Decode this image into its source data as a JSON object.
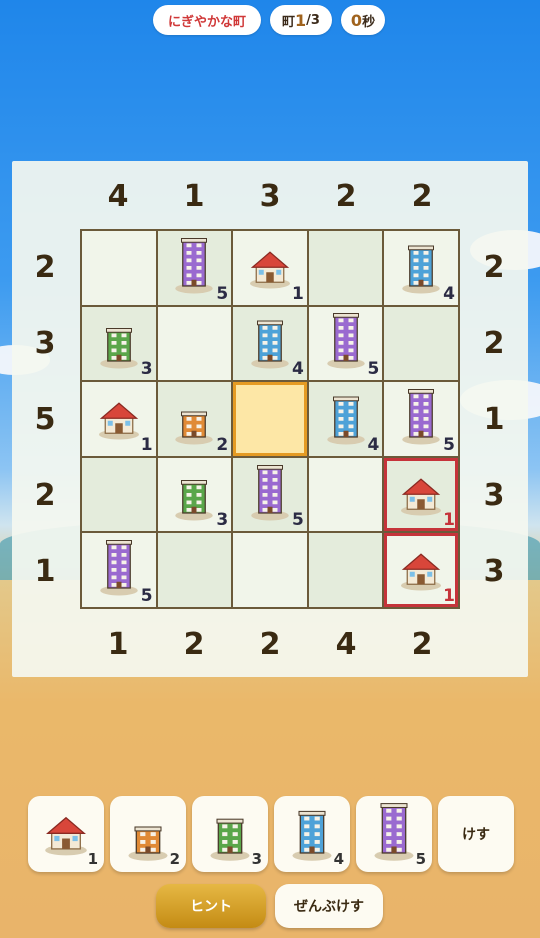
{
  "header": {
    "town_name": "にぎやかな町",
    "town_prefix": "町",
    "town_current": "1",
    "town_total": "/3",
    "time_value": "0",
    "time_unit": "秒"
  },
  "clues": {
    "top": [
      "4",
      "1",
      "3",
      "2",
      "2"
    ],
    "bottom": [
      "1",
      "2",
      "2",
      "4",
      "2"
    ],
    "left": [
      "2",
      "3",
      "5",
      "2",
      "1"
    ],
    "right": [
      "2",
      "2",
      "1",
      "3",
      "3"
    ]
  },
  "grid": [
    [
      0,
      5,
      1,
      0,
      4
    ],
    [
      3,
      0,
      4,
      5,
      0
    ],
    [
      1,
      2,
      0,
      4,
      5
    ],
    [
      0,
      3,
      5,
      0,
      1
    ],
    [
      5,
      0,
      0,
      0,
      1
    ]
  ],
  "grid_labels": [
    [
      "",
      "5",
      "1",
      "",
      "4"
    ],
    [
      "3",
      "",
      "4",
      "5",
      ""
    ],
    [
      "1",
      "2",
      "",
      "4",
      "5"
    ],
    [
      "",
      "3",
      "5",
      "",
      "1"
    ],
    [
      "5",
      "",
      "",
      "",
      "1"
    ]
  ],
  "selected_cell": [
    2,
    2
  ],
  "error_cells": [
    [
      3,
      4
    ],
    [
      4,
      4
    ]
  ],
  "building_colors": {
    "1": "#d8463a",
    "2": "#e08a36",
    "3": "#5aa64a",
    "4": "#4ea2d8",
    "5": "#9a6ad0"
  },
  "palette": {
    "items": [
      {
        "label": "1",
        "icon": "house-icon"
      },
      {
        "label": "2",
        "icon": "orange-building-icon"
      },
      {
        "label": "3",
        "icon": "green-building-icon"
      },
      {
        "label": "4",
        "icon": "blue-building-icon"
      },
      {
        "label": "5",
        "icon": "purple-building-icon"
      }
    ],
    "erase_label": "けす"
  },
  "buttons": {
    "hint": "ヒント",
    "clear_all": "ぜんぶけす"
  }
}
